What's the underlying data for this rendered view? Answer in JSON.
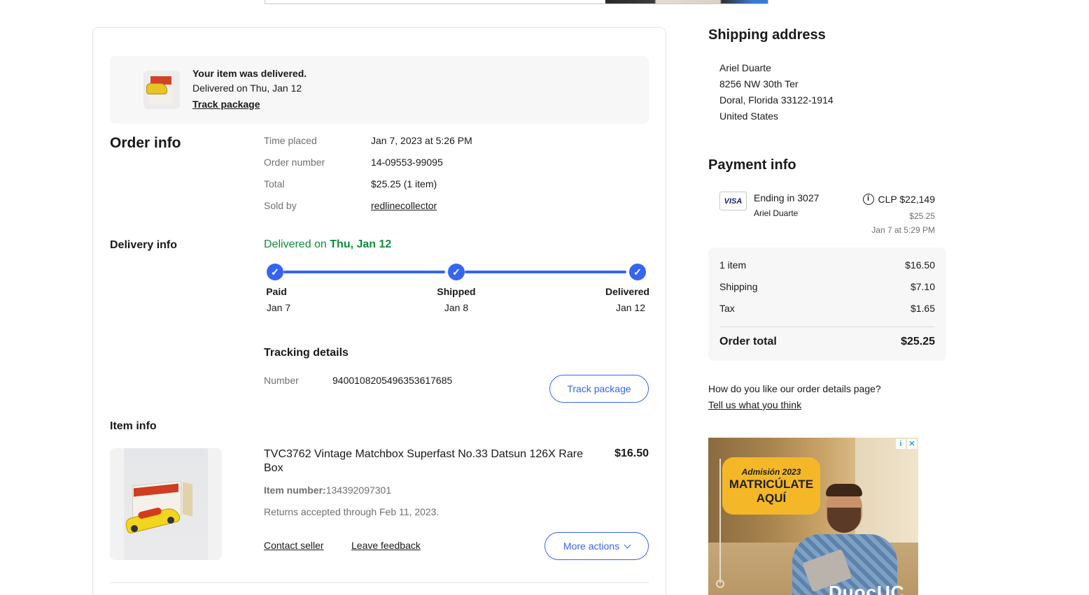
{
  "banner": {
    "title": "Your item was delivered.",
    "subtitle": "Delivered on Thu, Jan 12",
    "track_link": "Track package"
  },
  "order_info": {
    "heading": "Order info",
    "rows": [
      {
        "label": "Time placed",
        "value": "Jan 7, 2023 at 5:26 PM"
      },
      {
        "label": "Order number",
        "value": "14-09553-99095"
      },
      {
        "label": "Total",
        "value": "$25.25 (1 item)"
      },
      {
        "label": "Sold by",
        "value": "redlinecollector"
      }
    ]
  },
  "delivery_info": {
    "heading": "Delivery info",
    "status_prefix": "Delivered on",
    "status_date": "Thu, Jan 12",
    "steps": [
      {
        "label": "Paid",
        "date": "Jan 7",
        "complete": true
      },
      {
        "label": "Shipped",
        "date": "Jan 8",
        "complete": true
      },
      {
        "label": "Delivered",
        "date": "Jan 12",
        "complete": true
      }
    ],
    "tracking": {
      "heading": "Tracking details",
      "number_label": "Number",
      "number": "9400108205496353617685",
      "button": "Track package"
    }
  },
  "item_info": {
    "heading": "Item info",
    "title": "TVC3762 Vintage Matchbox Superfast No.33 Datsun 126X Rare Box",
    "price": "$16.50",
    "item_number_label": "Item number:",
    "item_number": "134392097301",
    "returns": "Returns accepted through Feb 11, 2023.",
    "contact_seller": "Contact seller",
    "leave_feedback": "Leave feedback",
    "more_actions": "More actions"
  },
  "shipping_address": {
    "heading": "Shipping address",
    "lines": [
      "Ariel Duarte",
      "8256 NW 30th Ter",
      "Doral, Florida 33122-1914",
      "United States"
    ]
  },
  "payment_info": {
    "heading": "Payment info",
    "card_brand": "VISA",
    "card_ending": "Ending in 3027",
    "card_holder": "Ariel Duarte",
    "clp_amount": "CLP $22,149",
    "usd_amount": "$25.25",
    "paid_date": "Jan 7 at 5:29 PM",
    "summary": [
      {
        "label": "1 item",
        "value": "$16.50"
      },
      {
        "label": "Shipping",
        "value": "$7.10"
      },
      {
        "label": "Tax",
        "value": "$1.65"
      }
    ],
    "total_label": "Order total",
    "total_value": "$25.25"
  },
  "feedback": {
    "question": "How do you like our order details page?",
    "link": "Tell us what you think"
  },
  "ad": {
    "line1": "Admisión 2023",
    "line2": "MATRICÚLATE",
    "line3": "AQUÍ",
    "brand": "DuocUC"
  },
  "colors": {
    "accent_blue": "#3665f3",
    "delivered_green": "#118a3d",
    "panel_gray": "#f7f7f7"
  }
}
